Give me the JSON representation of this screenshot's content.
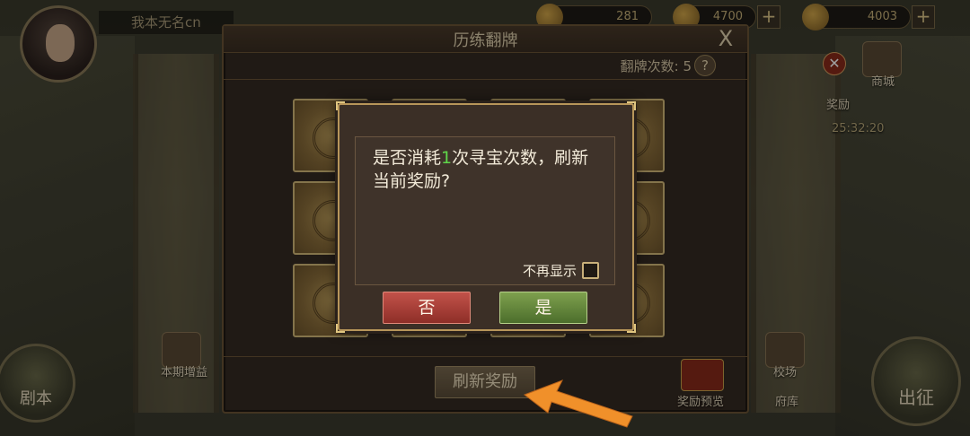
{
  "topbar": {
    "player_name": "我本无名cn",
    "currency_1": "281",
    "currency_2": "4700",
    "currency_3": "4003",
    "plus": "+"
  },
  "left_side": {
    "bonus_label": "本期增益",
    "script_label": "剧本"
  },
  "right_side": {
    "shop_label": "商城",
    "reward_label": "奖励",
    "timer": "25:32:20",
    "arena_label": "校场",
    "warehouse_label": "府库",
    "battle_label": "出征"
  },
  "panel": {
    "title": "历练翻牌",
    "close": "X",
    "flip_count_label": "翻牌次数:",
    "flip_count": "5",
    "help": "?",
    "refresh_button": "刷新奖励",
    "preview_label": "奖励预览"
  },
  "dialog": {
    "text_before": "是否消耗",
    "cost": "1",
    "text_after": "次寻宝次数，刷新当前奖励?",
    "dont_show_label": "不再显示",
    "no_button": "否",
    "yes_button": "是"
  },
  "colors": {
    "highlight_green": "#5fd64a",
    "no_red": "#c2524a",
    "yes_green": "#7ea04e",
    "arrow_orange": "#f0902a"
  }
}
